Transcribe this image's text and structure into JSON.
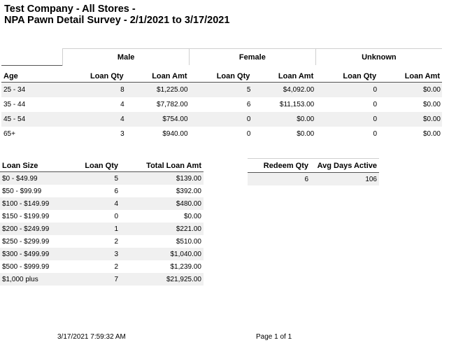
{
  "report": {
    "title_line1": "Test Company - All Stores -",
    "title_line2": "NPA Pawn Detail Survey - 2/1/2021 to 3/17/2021"
  },
  "age_table": {
    "groups": [
      "Male",
      "Female",
      "Unknown"
    ],
    "headers": [
      "Age",
      "Loan Qty",
      "Loan Amt",
      "Loan Qty",
      "Loan Amt",
      "Loan Qty",
      "Loan Amt"
    ],
    "rows": [
      [
        "25 - 34",
        "8",
        "$1,225.00",
        "5",
        "$4,092.00",
        "0",
        "$0.00"
      ],
      [
        "35 - 44",
        "4",
        "$7,782.00",
        "6",
        "$11,153.00",
        "0",
        "$0.00"
      ],
      [
        "45 - 54",
        "4",
        "$754.00",
        "0",
        "$0.00",
        "0",
        "$0.00"
      ],
      [
        "65+",
        "3",
        "$940.00",
        "0",
        "$0.00",
        "0",
        "$0.00"
      ]
    ]
  },
  "loan_size_table": {
    "headers": [
      "Loan Size",
      "Loan Qty",
      "Total Loan Amt"
    ],
    "rows": [
      [
        "$0 - $49.99",
        "5",
        "$139.00"
      ],
      [
        "$50 - $99.99",
        "6",
        "$392.00"
      ],
      [
        "$100 - $149.99",
        "4",
        "$480.00"
      ],
      [
        "$150 - $199.99",
        "0",
        "$0.00"
      ],
      [
        "$200 - $249.99",
        "1",
        "$221.00"
      ],
      [
        "$250 - $299.99",
        "2",
        "$510.00"
      ],
      [
        "$300 - $499.99",
        "3",
        "$1,040.00"
      ],
      [
        "$500 - $999.99",
        "2",
        "$1,239.00"
      ],
      [
        "$1,000 plus",
        "7",
        "$21,925.00"
      ]
    ]
  },
  "redeem_table": {
    "headers": [
      "Redeem Qty",
      "Avg Days Active"
    ],
    "rows": [
      [
        "6",
        "106"
      ]
    ]
  },
  "footer": {
    "timestamp": "3/17/2021 7:59:32 AM",
    "page": "Page 1 of 1"
  }
}
